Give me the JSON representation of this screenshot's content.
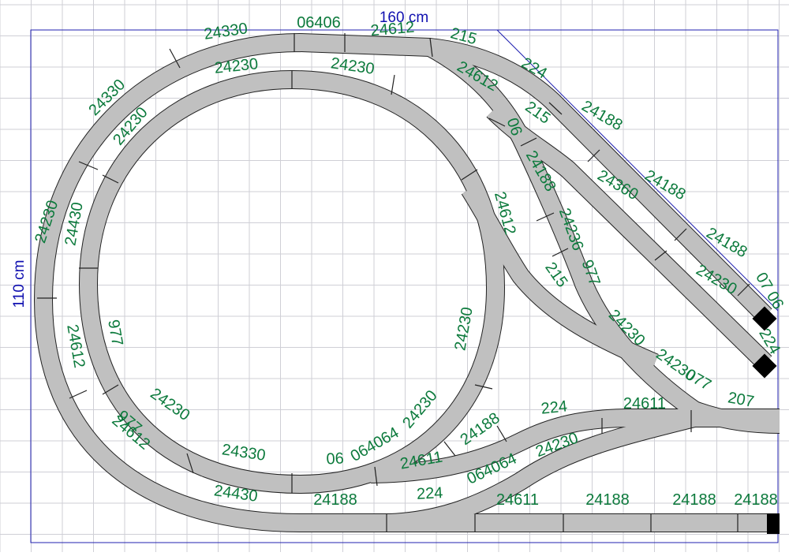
{
  "colors": {
    "background": "#ffffff",
    "grid": "#cfcfd6",
    "frame": "#2020b0",
    "dimension_text": "#1010b0",
    "track_fill": "#c0c0c0",
    "track_edge": "#222222",
    "label": "#0c7a3c",
    "buffer_stop": "#000000"
  },
  "dimensions": {
    "width_label": "160 cm",
    "height_label": "110 cm"
  },
  "part_labels": [
    "06406",
    "24330",
    "24612",
    "215",
    "224",
    "24330",
    "24230",
    "24230",
    "24612",
    "215",
    "24230",
    "06",
    "24188",
    "24188",
    "24188",
    "24360",
    "24230",
    "24188",
    "24612",
    "24430",
    "24230",
    "24236",
    "07 06",
    "977",
    "215",
    "224",
    "977",
    "24230",
    "24230",
    "24612",
    "24230",
    "077",
    "207",
    "24612",
    "24230",
    "24230",
    "224",
    "24611",
    "24330",
    "06",
    "064064",
    "24188",
    "24230",
    "24611",
    "224",
    "064064",
    "24430",
    "24188",
    "24611",
    "24188",
    "24188",
    "24188",
    "977"
  ]
}
